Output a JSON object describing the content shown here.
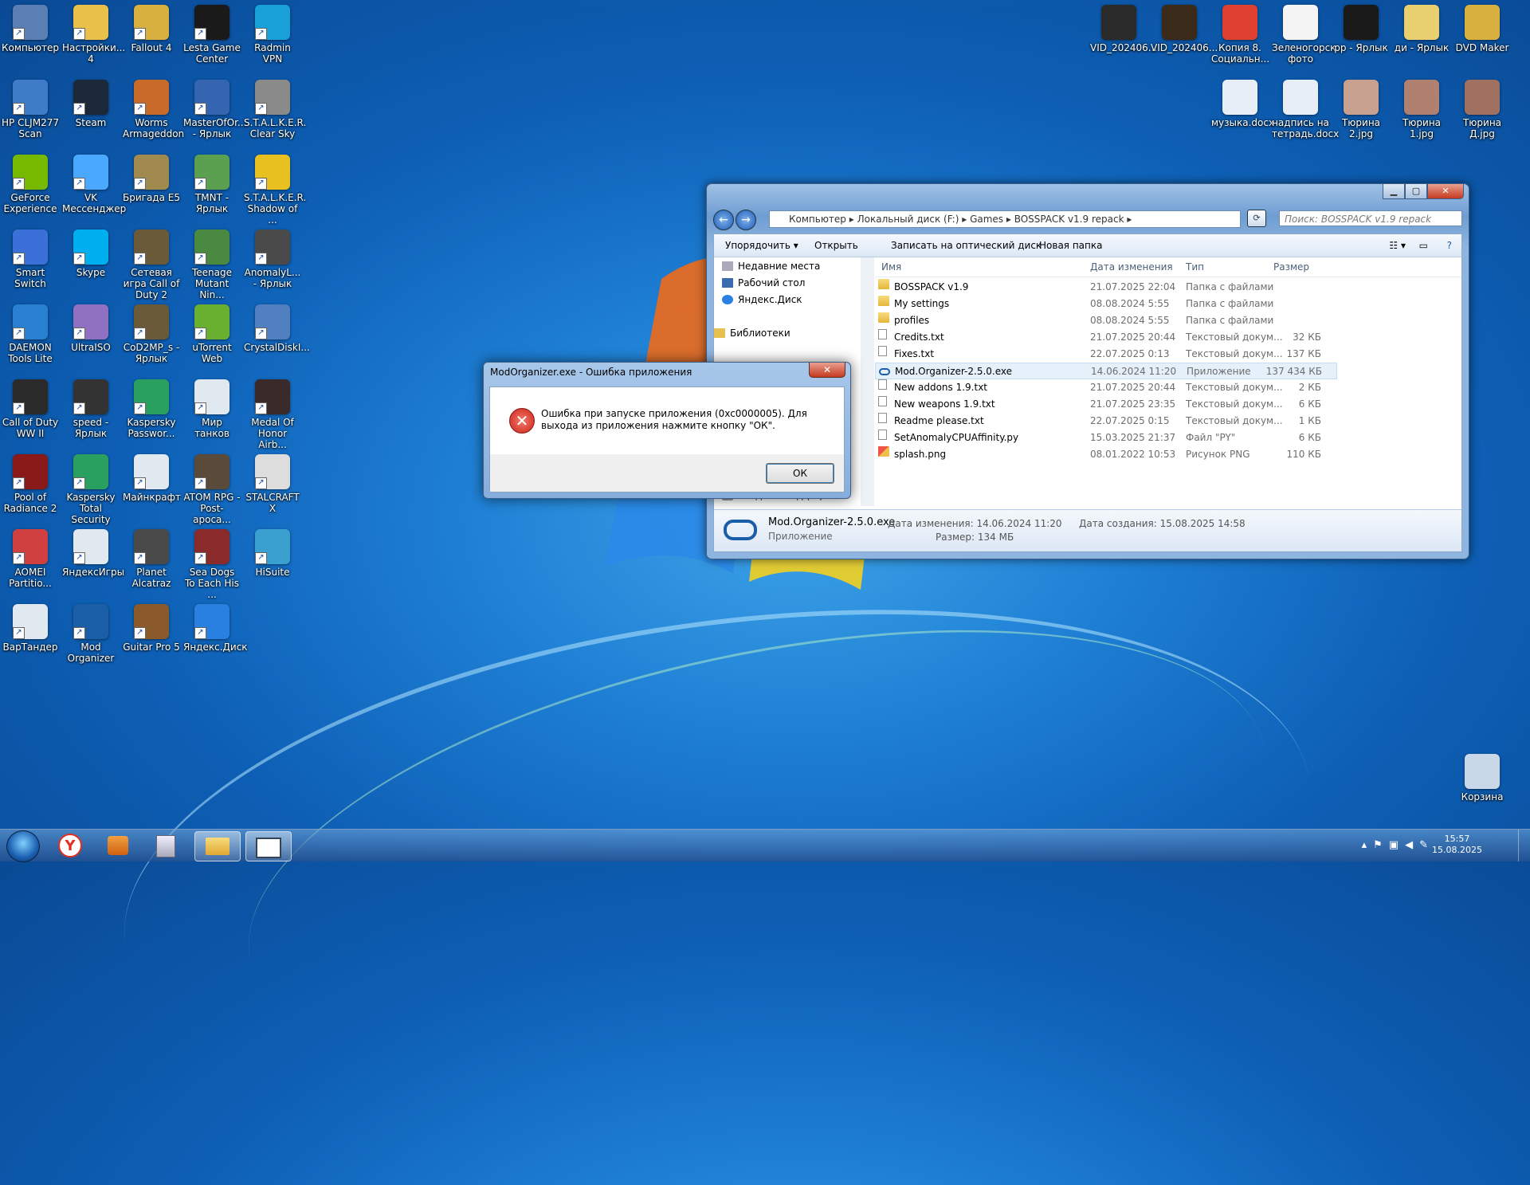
{
  "desktop_left": [
    {
      "label": "Компьютер",
      "color": "#5a7fb5"
    },
    {
      "label": "Настройки... 4",
      "color": "#e8c04a"
    },
    {
      "label": "Fallout 4",
      "color": "#d8b040"
    },
    {
      "label": "Lesta Game Center",
      "color": "#1a1a1a"
    },
    {
      "label": "Radmin VPN",
      "color": "#1aa0d8"
    },
    {
      "label": "HP CLJM277 Scan",
      "color": "#3e7cc8"
    },
    {
      "label": "Steam",
      "color": "#1b2838"
    },
    {
      "label": "Worms Armageddon",
      "color": "#c86a2a"
    },
    {
      "label": "MasterOfOr... - Ярлык",
      "color": "#3565b0"
    },
    {
      "label": "S.T.A.L.K.E.R. Clear Sky",
      "color": "#8a8a8a"
    },
    {
      "label": "GeForce Experience",
      "color": "#76b900"
    },
    {
      "label": "VK Мессенджер",
      "color": "#4aa8ff"
    },
    {
      "label": "Бригада E5",
      "color": "#a08a50"
    },
    {
      "label": "TMNT - Ярлык",
      "color": "#5aa050"
    },
    {
      "label": "S.T.A.L.K.E.R. Shadow of ...",
      "color": "#e8c020"
    },
    {
      "label": "Smart Switch",
      "color": "#3a70d8"
    },
    {
      "label": "Skype",
      "color": "#00aff0"
    },
    {
      "label": "Сетевая игра Call of Duty 2",
      "color": "#6a5a3a"
    },
    {
      "label": "Teenage Mutant Nin...",
      "color": "#4a8a40"
    },
    {
      "label": "AnomalyL... - Ярлык",
      "color": "#4a4a4a"
    },
    {
      "label": "DAEMON Tools Lite",
      "color": "#2a80d0"
    },
    {
      "label": "UltraISO",
      "color": "#9070c0"
    },
    {
      "label": "CoD2MP_s - Ярлык",
      "color": "#6a5a3a"
    },
    {
      "label": "uTorrent Web",
      "color": "#6ab030"
    },
    {
      "label": "CrystalDiskI...",
      "color": "#5080c0"
    },
    {
      "label": "Call of Duty WW II",
      "color": "#2a2a2a"
    },
    {
      "label": "speed - Ярлык",
      "color": "#333333"
    },
    {
      "label": "Kaspersky Passwor...",
      "color": "#2aa060"
    },
    {
      "label": "Мир танков",
      "color": "#e0e8f0"
    },
    {
      "label": "Medal Of Honor Airb...",
      "color": "#3a2a2a"
    },
    {
      "label": "Pool of Radiance 2",
      "color": "#8a1a1a"
    },
    {
      "label": "Kaspersky Total Security",
      "color": "#2aa060"
    },
    {
      "label": "Майнкрафт",
      "color": "#e0e8f0"
    },
    {
      "label": "ATOM RPG - Post-apoca...",
      "color": "#5a4a3a"
    },
    {
      "label": "STALCRAFT X",
      "color": "#dddddd"
    },
    {
      "label": "AOMEI Partitio...",
      "color": "#d04040"
    },
    {
      "label": "ЯндексИгры",
      "color": "#e0e8f0"
    },
    {
      "label": "Planet Alcatraz",
      "color": "#4a4a4a"
    },
    {
      "label": "Sea Dogs To Each His ...",
      "color": "#8a2a2a"
    },
    {
      "label": "HiSuite",
      "color": "#3aa0d0"
    },
    {
      "label": "ВарТандер",
      "color": "#e0e8f0"
    },
    {
      "label": "Mod Organizer",
      "color": "#1a5ea8"
    },
    {
      "label": "Guitar Pro 5",
      "color": "#8a5a2a"
    },
    {
      "label": "Яндекс.Диск",
      "color": "#2a80e0"
    }
  ],
  "desktop_right": [
    {
      "label": "VID_202406...",
      "color": "#2a2a2a"
    },
    {
      "label": "VID_202406...",
      "color": "#3a2a1a"
    },
    {
      "label": "Копия 8. Социальн...",
      "color": "#e04030"
    },
    {
      "label": "Зеленогорск фото",
      "color": "#f4f4f4"
    },
    {
      "label": "рр - Ярлык",
      "color": "#1a1a1a"
    },
    {
      "label": "ди - Ярлык",
      "color": "#e8d070"
    },
    {
      "label": "DVD Maker",
      "color": "#d8b040"
    },
    {
      "label": "музыка.docx",
      "color": "#e8eef8"
    },
    {
      "label": "надпись на тетрадь.docx",
      "color": "#e8eef8"
    },
    {
      "label": "Тюрина 2.jpg",
      "color": "#c8a090"
    },
    {
      "label": "Тюрина 1.jpg",
      "color": "#b08070"
    },
    {
      "label": "Тюрина Д.jpg",
      "color": "#a07060"
    },
    {
      "label": "Корзина",
      "color": "#c8d8e8"
    }
  ],
  "explorer": {
    "address": [
      "Компьютер",
      "Локальный диск (F:)",
      "Games",
      "BOSSPACK v1.9 repack"
    ],
    "search_placeholder": "Поиск: BOSSPACK v1.9 repack",
    "toolbar": {
      "organize": "Упорядочить ▾",
      "open": "Открыть",
      "burn": "Записать на оптический диск",
      "new_folder": "Новая папка"
    },
    "nav": [
      "Недавние места",
      "Рабочий стол",
      "Яндекс.Диск",
      "Библиотеки"
    ],
    "nav_bottom": "CD-дисковод (E:)",
    "columns": {
      "name": "Имя",
      "date": "Дата изменения",
      "type": "Тип",
      "size": "Размер"
    },
    "files": [
      {
        "name": "BOSSPACK v1.9",
        "date": "21.07.2025 22:04",
        "type": "Папка с файлами",
        "size": "",
        "icon": "folder"
      },
      {
        "name": "My settings",
        "date": "08.08.2024 5:55",
        "type": "Папка с файлами",
        "size": "",
        "icon": "folder"
      },
      {
        "name": "profiles",
        "date": "08.08.2024 5:55",
        "type": "Папка с файлами",
        "size": "",
        "icon": "folder"
      },
      {
        "name": "Credits.txt",
        "date": "21.07.2025 20:44",
        "type": "Текстовый докум...",
        "size": "32 КБ",
        "icon": "txt"
      },
      {
        "name": "Fixes.txt",
        "date": "22.07.2025 0:13",
        "type": "Текстовый докум...",
        "size": "137 КБ",
        "icon": "txt"
      },
      {
        "name": "Mod.Organizer-2.5.0.exe",
        "date": "14.06.2024 11:20",
        "type": "Приложение",
        "size": "137 434 КБ",
        "icon": "app"
      },
      {
        "name": "New addons 1.9.txt",
        "date": "21.07.2025 20:44",
        "type": "Текстовый докум...",
        "size": "2 КБ",
        "icon": "txt"
      },
      {
        "name": "New weapons 1.9.txt",
        "date": "21.07.2025 23:35",
        "type": "Текстовый докум...",
        "size": "6 КБ",
        "icon": "txt"
      },
      {
        "name": "Readme please.txt",
        "date": "22.07.2025 0:15",
        "type": "Текстовый докум...",
        "size": "1 КБ",
        "icon": "txt"
      },
      {
        "name": "SetAnomalyCPUAffinity.py",
        "date": "15.03.2025 21:37",
        "type": "Файл \"PY\"",
        "size": "6 КБ",
        "icon": "txt"
      },
      {
        "name": "splash.png",
        "date": "08.01.2022 10:53",
        "type": "Рисунок PNG",
        "size": "110 КБ",
        "icon": "png"
      }
    ],
    "details": {
      "name": "Mod.Organizer-2.5.0.exe",
      "kind": "Приложение",
      "modified": "Дата изменения: 14.06.2024 11:20",
      "size": "Размер: 134 МБ",
      "created": "Дата создания: 15.08.2025 14:58"
    }
  },
  "dialog": {
    "title": "ModOrganizer.exe - Ошибка приложения",
    "message": "Ошибка при запуске приложения (0xc0000005). Для выхода из приложения нажмите кнопку \"ОК\".",
    "ok": "ОК"
  },
  "taskbar": {
    "time": "15:57",
    "date": "15.08.2025"
  }
}
